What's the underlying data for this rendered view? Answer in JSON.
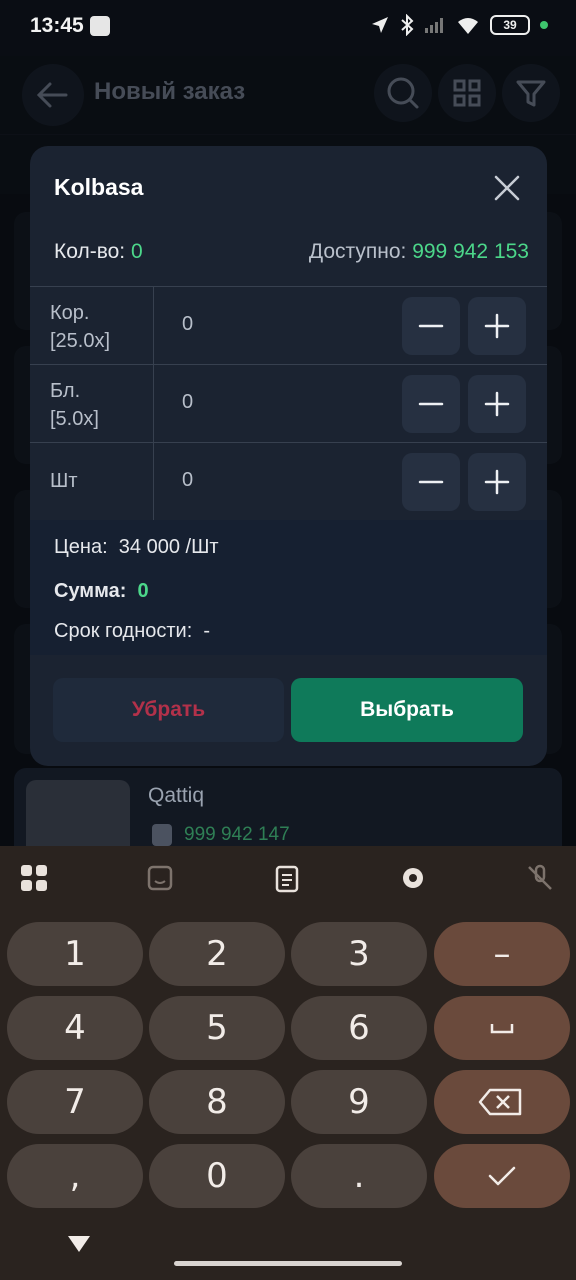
{
  "status_bar": {
    "time": "13:45",
    "battery": "39"
  },
  "app_bar": {
    "title": "Новый заказ"
  },
  "background_item": {
    "name": "Qattiq",
    "quantity": "999 942 147"
  },
  "dialog": {
    "title": "Kolbasa",
    "qty_label": "Кол-во:",
    "qty_value": "0",
    "available_label": "Доступно:",
    "available_value": "999 942 153",
    "units": [
      {
        "label_line1": "Кор.",
        "label_line2": "[25.0x]",
        "value": "0"
      },
      {
        "label_line1": "Бл.",
        "label_line2": "[5.0x]",
        "value": "0"
      },
      {
        "label_line1": "Шт",
        "label_line2": "",
        "value": "0"
      }
    ],
    "price_label": "Цена:",
    "price_value": "34 000 /Шт",
    "sum_label": "Сумма:",
    "sum_value": "0",
    "expiry_label": "Срок годности:",
    "expiry_value": "-",
    "remove_button": "Убрать",
    "select_button": "Выбрать"
  },
  "keyboard": {
    "keys": [
      "1",
      "2",
      "3",
      "4",
      "5",
      "6",
      "7",
      "8",
      "9",
      ",",
      "0",
      "."
    ],
    "minus_key": "–"
  },
  "colors": {
    "accent_green": "#4cd78a",
    "select_button": "#0f7a5a",
    "remove_text": "#b3314a"
  }
}
